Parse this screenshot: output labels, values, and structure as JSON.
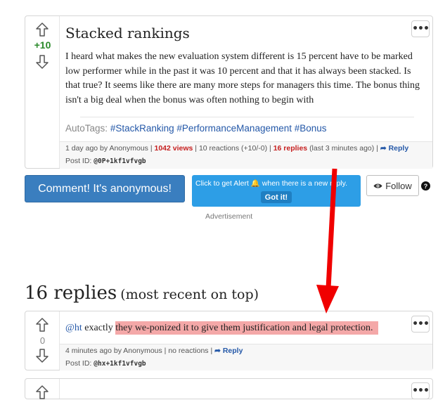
{
  "post": {
    "score": "+10",
    "title": "Stacked rankings",
    "body": "I heard what makes the new evaluation system different is 15 percent have to be marked low performer while in the past it was 10 percent and that it has always been stacked. Is that true? It seems like there are many more steps for managers this time. The bonus thing isn't a big deal when the bonus was often nothing to begin with",
    "autotags_label": "AutoTags:",
    "tags": [
      "#StackRanking",
      "#PerformanceManagement",
      "#Bonus"
    ],
    "time": "1 day ago by Anonymous",
    "views": "1042 views",
    "reactions": "10 reactions (+10/-0)",
    "replies_count": "16 replies",
    "last_reply": "(last 3 minutes ago)",
    "reply_label": "Reply",
    "post_id_label": "Post ID:",
    "post_id": "@0P+1kf1vfvgb"
  },
  "actions": {
    "comment_label": "Comment! It's anonymous!",
    "alert_text_before": "Click to get Alert",
    "alert_text_after": "when there is a new reply.",
    "got_it_label": "Got it!",
    "follow_label": "Follow",
    "help_label": "?",
    "advertisement": "Advertisement"
  },
  "replies_header": {
    "count": "16 replies",
    "order": "(most recent on top)"
  },
  "reply1": {
    "score": "0",
    "mention": "@ht",
    "text_plain": "exactly",
    "text_highlighted": "they we-ponized it to give them justification and legal protection.",
    "time": "4 minutes ago by Anonymous",
    "reactions": "no reactions",
    "reply_label": "Reply",
    "post_id_label": "Post ID:",
    "post_id": "@hx+1kf1vfvgb"
  },
  "colors": {
    "accent": "#2458a8",
    "score_positive": "#2a8a2a",
    "views_red": "#c62020",
    "annotation_arrow": "#f00000",
    "highlight": "#f4a8a8"
  }
}
